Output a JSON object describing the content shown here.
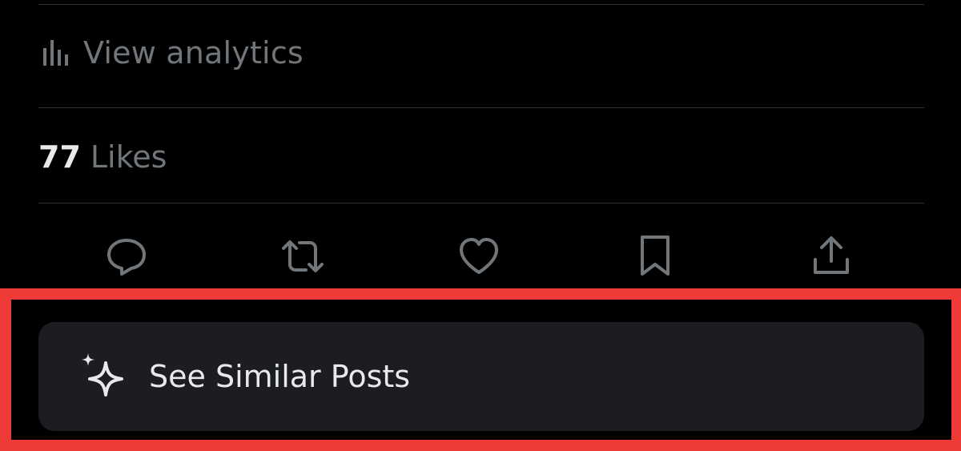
{
  "analytics": {
    "label": "View analytics",
    "icon": "bar-chart-icon"
  },
  "likes": {
    "count": "77",
    "label": "Likes"
  },
  "actions": [
    {
      "name": "reply",
      "icon": "speech-bubble-icon"
    },
    {
      "name": "repost",
      "icon": "repost-arrows-icon"
    },
    {
      "name": "like",
      "icon": "heart-icon"
    },
    {
      "name": "bookmark",
      "icon": "bookmark-icon"
    },
    {
      "name": "share",
      "icon": "share-upload-icon"
    }
  ],
  "similar_posts": {
    "label": "See Similar Posts",
    "icon": "sparkle-icon"
  },
  "colors": {
    "background": "#000000",
    "divider": "#2f3336",
    "muted_text": "#71767b",
    "primary_text": "#e7e9ea",
    "card_background": "#1c1d20",
    "highlight": "#ee3b38"
  }
}
